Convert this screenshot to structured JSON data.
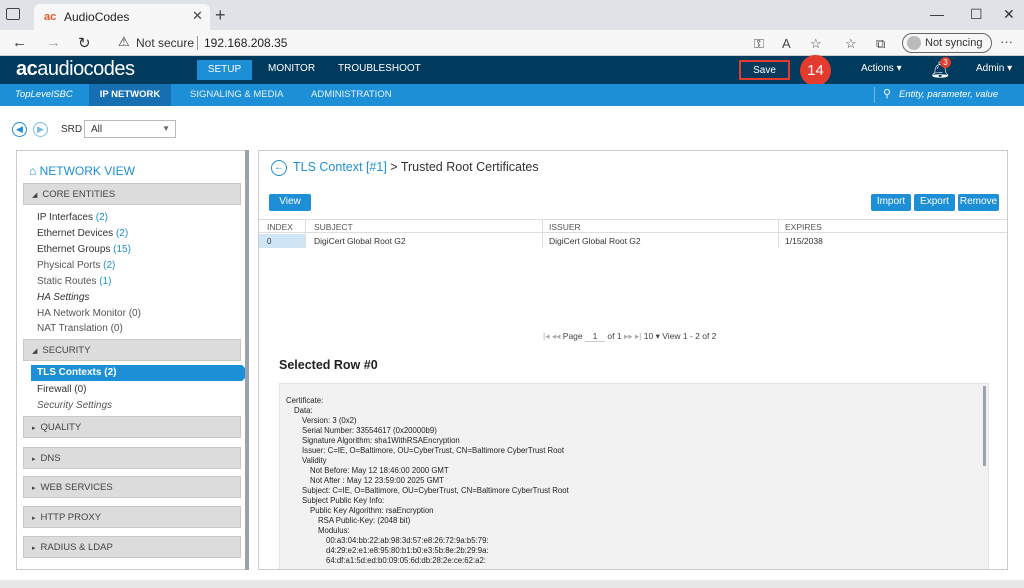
{
  "browser": {
    "tab_title": "AudioCodes",
    "tab_logo": "ac",
    "url_warning": "Not secure",
    "url": "192.168.208.35",
    "sync_label": "Not syncing"
  },
  "app": {
    "brand_prefix": "ac",
    "brand_name": "audiocodes",
    "menus": [
      "SETUP",
      "MONITOR",
      "TROUBLESHOOT"
    ],
    "save_label": "Save",
    "step_badge": "14",
    "actions_label": "Actions",
    "notifications_count": "3",
    "admin_label": "Admin"
  },
  "subnav": {
    "top_level": "TopLevelSBC",
    "items": [
      "IP NETWORK",
      "SIGNALING & MEDIA",
      "ADMINISTRATION"
    ],
    "search_placeholder": "Entity, parameter, value"
  },
  "toolbar": {
    "srd_label": "SRD",
    "srd_value": "All"
  },
  "network_view": {
    "title": "NETWORK VIEW",
    "core_entities": {
      "label": "CORE ENTITIES",
      "items": [
        {
          "label": "IP Interfaces",
          "count": "(2)"
        },
        {
          "label": "Ethernet Devices",
          "count": "(2)"
        },
        {
          "label": "Ethernet Groups",
          "count": "(15)"
        },
        {
          "label": "Physical Ports",
          "count": "(2)"
        },
        {
          "label": "Static Routes",
          "count": "(1)"
        },
        {
          "label": "HA Settings",
          "count": ""
        },
        {
          "label": "HA Network Monitor",
          "count": "(0)"
        },
        {
          "label": "NAT Translation",
          "count": "(0)"
        }
      ]
    },
    "security": {
      "label": "SECURITY",
      "items": [
        {
          "label": "TLS Contexts",
          "count": "(2)"
        },
        {
          "label": "Firewall",
          "count": "(0)"
        },
        {
          "label": "Security Settings",
          "count": ""
        }
      ]
    },
    "collapsed_sections": [
      "QUALITY",
      "DNS",
      "WEB SERVICES",
      "HTTP PROXY",
      "RADIUS & LDAP"
    ]
  },
  "page": {
    "title_link": "TLS Context [#1]",
    "title_rest": " > Trusted Root Certificates",
    "buttons": {
      "view": "View",
      "import": "Import",
      "export": "Export",
      "remove": "Remove"
    },
    "columns": [
      "INDEX",
      "SUBJECT",
      "ISSUER",
      "EXPIRES"
    ],
    "rows": [
      {
        "index": "0",
        "subject": "DigiCert Global Root G2",
        "issuer": "DigiCert Global Root G2",
        "expires": "1/15/2038"
      }
    ],
    "pager": {
      "page_label": "Page",
      "page": "1",
      "of_label": "of 1",
      "per_page": "10",
      "view_text": "View 1 - 2 of 2"
    },
    "selected_title": "Selected Row #0",
    "certificate_lines": [
      "Certificate:",
      "Data:",
      "Version: 3 (0x2)",
      "Serial Number: 33554617 (0x20000b9)",
      "Signature Algorithm: sha1WithRSAEncryption",
      "Issuer: C=IE, O=Baltimore, OU=CyberTrust, CN=Baltimore CyberTrust Root",
      "Validity",
      "Not Before: May 12 18:46:00 2000 GMT",
      "Not After : May 12 23:59:00 2025 GMT",
      "Subject: C=IE, O=Baltimore, OU=CyberTrust, CN=Baltimore CyberTrust Root",
      "Subject Public Key Info:",
      "Public Key Algorithm: rsaEncryption",
      "RSA Public-Key: (2048 bit)",
      "Modulus:",
      "00:a3:04:bb:22:ab:98:3d:57:e8:26:72:9a:b5:79:",
      "d4:29:e2:e1:e8:95:80:b1:b0:e3:5b:8e:2b:29:9a:",
      "64:df:a1:5d:ed:b0:09:05:6d:db:28:2e:ce:62:a2:"
    ]
  }
}
